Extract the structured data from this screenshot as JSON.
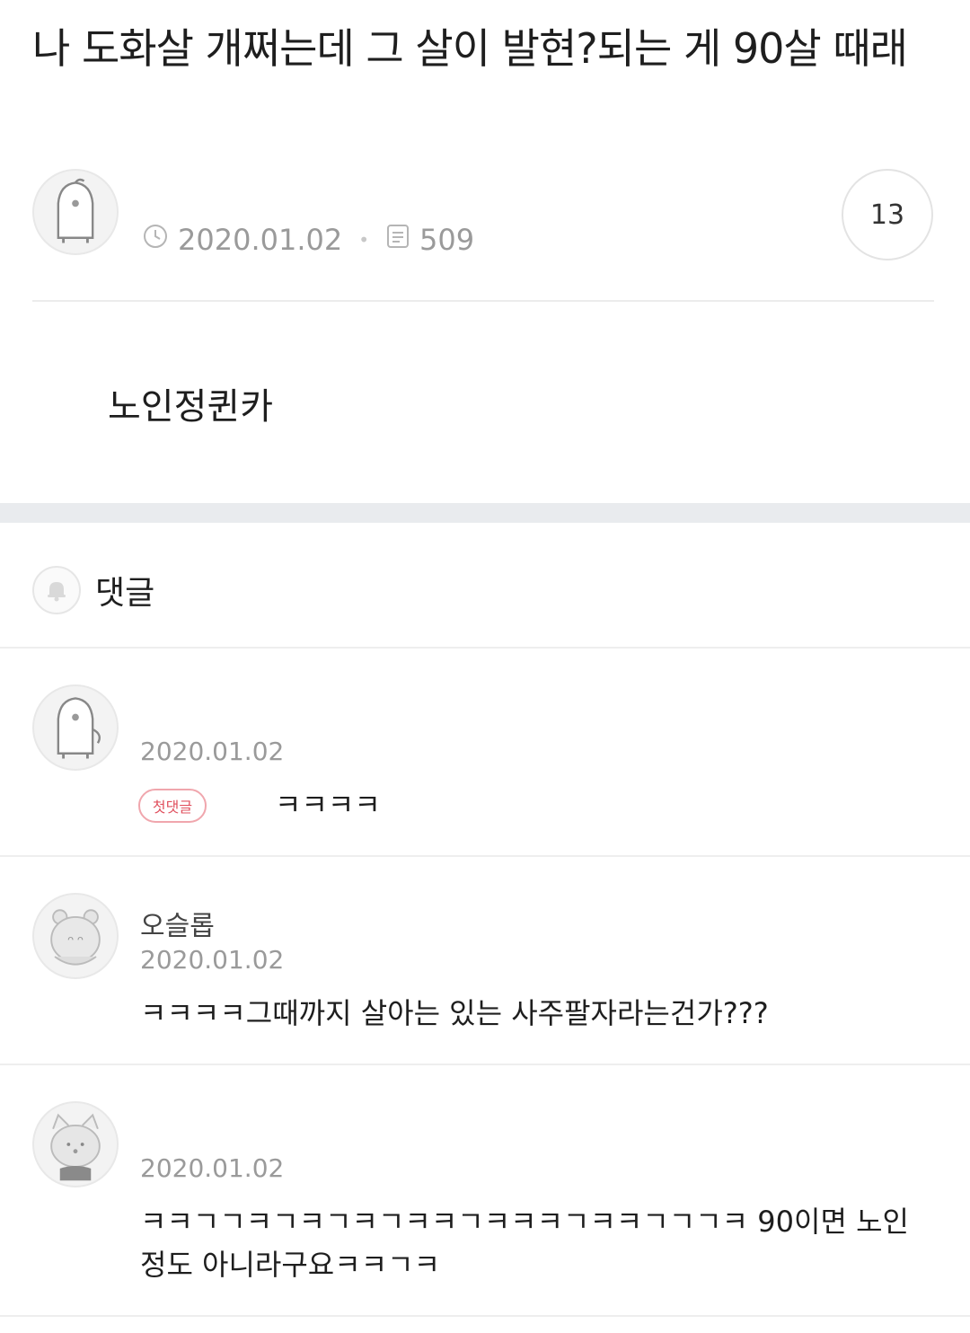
{
  "post": {
    "title": "나 도화살 개쩌는데 그 살이 발현?되는 게 90살 때래",
    "date": "2020.01.02",
    "views": "509",
    "comment_count": "13",
    "body": "노인정퀸카"
  },
  "comments_section": {
    "label": "댓글"
  },
  "comments": [
    {
      "name": "",
      "date": "2020.01.02",
      "badge": "첫댓글",
      "text": "ㅋㅋㅋㅋ"
    },
    {
      "name": "오슬롭",
      "date": "2020.01.02",
      "text": "ㅋㅋㅋㅋ그때까지 살아는 있는 사주팔자라는건가???"
    },
    {
      "name": "",
      "date": "2020.01.02",
      "text": "ㅋㅋㄱㄱㅋㄱㅋㄱㅋㄱㅋㅋㄱㅋㅋㅋㄱㅋㅋㄱㄱㄱㅋ 90이면 노인정도 아니라구요ㅋㅋㄱㅋ"
    }
  ],
  "icons": {
    "clock": "clock-icon",
    "views": "document-icon",
    "bell": "bell-icon",
    "avatar_penguin": "penguin-avatar-icon",
    "avatar_bear": "bear-avatar-icon",
    "avatar_cat": "cat-avatar-icon"
  },
  "colors": {
    "badge": "#e0505e",
    "meta_text": "#9a9a9a",
    "section_gap": "#e9ebee"
  }
}
